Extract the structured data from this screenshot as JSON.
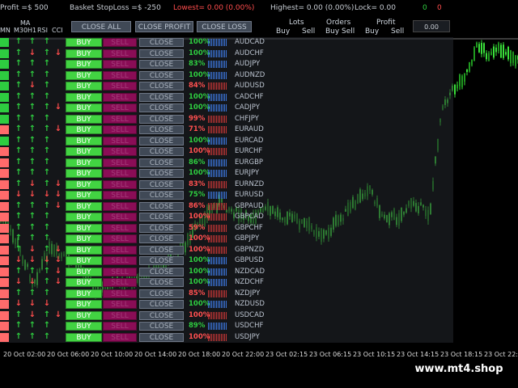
{
  "topbar": {
    "profit": "Profit =$ 500",
    "basket_stoploss": "Basket StopLoss =$ -250",
    "lowest": "Lowest= 0.00 (0.00%)",
    "highest": "Highest= 0.00 (0.00%)",
    "lock": "Lock= 0.00",
    "count_green": "0",
    "count_red": "0"
  },
  "headers": {
    "ma": "MA",
    "mn": "MN",
    "m30": "M30",
    "h1": "H1",
    "rsi": "RSI",
    "cci": "CCI",
    "lots": "Lots",
    "orders": "Orders",
    "profit": "Profit",
    "buy": "Buy",
    "sell": "Sell",
    "profit_value": "0.00"
  },
  "buttons": {
    "close_all": "CLOSE ALL",
    "close_profit": "CLOSE PROFIT",
    "close_loss": "CLOSE LOSS"
  },
  "row_labels": {
    "buy": "BUY",
    "sell": "SELL",
    "close": "CLOSE"
  },
  "colors": {
    "green": "#2ecc40",
    "red": "#ff5050",
    "buy_bg": "#42d342",
    "sell_bg": "#8a0d56",
    "bar_blue": "#3b74d8",
    "bar_red": "#c03535"
  },
  "pairs": [
    {
      "symbol": "AUDCAD",
      "percent": "100%",
      "color": "green",
      "lead": "green",
      "arrows": [
        "up",
        "up",
        "up",
        ""
      ]
    },
    {
      "symbol": "AUDCHF",
      "percent": "100%",
      "color": "green",
      "lead": "green",
      "arrows": [
        "up",
        "down",
        "up",
        "down"
      ]
    },
    {
      "symbol": "AUDJPY",
      "percent": "83%",
      "color": "green",
      "lead": "green",
      "arrows": [
        "up",
        "up",
        "up",
        ""
      ]
    },
    {
      "symbol": "AUDNZD",
      "percent": "100%",
      "color": "green",
      "lead": "green",
      "arrows": [
        "up",
        "up",
        "up",
        ""
      ]
    },
    {
      "symbol": "AUDUSD",
      "percent": "84%",
      "color": "red",
      "lead": "green",
      "arrows": [
        "up",
        "down",
        "up",
        ""
      ]
    },
    {
      "symbol": "CADCHF",
      "percent": "100%",
      "color": "green",
      "lead": "green",
      "arrows": [
        "up",
        "up",
        "up",
        ""
      ]
    },
    {
      "symbol": "CADJPY",
      "percent": "100%",
      "color": "green",
      "lead": "green",
      "arrows": [
        "up",
        "up",
        "up",
        "down"
      ]
    },
    {
      "symbol": "CHFJPY",
      "percent": "99%",
      "color": "red",
      "lead": "green",
      "arrows": [
        "up",
        "up",
        "up",
        ""
      ]
    },
    {
      "symbol": "EURAUD",
      "percent": "71%",
      "color": "red",
      "lead": "red",
      "arrows": [
        "up",
        "up",
        "up",
        "down"
      ]
    },
    {
      "symbol": "EURCAD",
      "percent": "100%",
      "color": "green",
      "lead": "green",
      "arrows": [
        "up",
        "up",
        "up",
        ""
      ]
    },
    {
      "symbol": "EURCHF",
      "percent": "100%",
      "color": "red",
      "lead": "red",
      "arrows": [
        "up",
        "up",
        "up",
        ""
      ]
    },
    {
      "symbol": "EURGBP",
      "percent": "86%",
      "color": "green",
      "lead": "red",
      "arrows": [
        "up",
        "up",
        "up",
        ""
      ]
    },
    {
      "symbol": "EURJPY",
      "percent": "100%",
      "color": "green",
      "lead": "red",
      "arrows": [
        "up",
        "up",
        "up",
        ""
      ]
    },
    {
      "symbol": "EURNZD",
      "percent": "83%",
      "color": "red",
      "lead": "red",
      "arrows": [
        "up",
        "down",
        "up",
        "down"
      ]
    },
    {
      "symbol": "EURUSD",
      "percent": "75%",
      "color": "green",
      "lead": "red",
      "arrows": [
        "down",
        "down",
        "down",
        "down"
      ]
    },
    {
      "symbol": "GBPAUD",
      "percent": "86%",
      "color": "red",
      "lead": "red",
      "arrows": [
        "up",
        "up",
        "up",
        "down"
      ]
    },
    {
      "symbol": "GBPCAD",
      "percent": "100%",
      "color": "red",
      "lead": "red",
      "arrows": [
        "up",
        "up",
        "up",
        ""
      ]
    },
    {
      "symbol": "GBPCHF",
      "percent": "59%",
      "color": "red",
      "lead": "red",
      "arrows": [
        "up",
        "up",
        "up",
        ""
      ]
    },
    {
      "symbol": "GBPJPY",
      "percent": "100%",
      "color": "red",
      "lead": "red",
      "arrows": [
        "up",
        "up",
        "up",
        ""
      ]
    },
    {
      "symbol": "GBPNZD",
      "percent": "100%",
      "color": "red",
      "lead": "red",
      "arrows": [
        "up",
        "down",
        "up",
        "down"
      ]
    },
    {
      "symbol": "GBPUSD",
      "percent": "100%",
      "color": "green",
      "lead": "red",
      "arrows": [
        "down",
        "down",
        "down",
        "down"
      ]
    },
    {
      "symbol": "NZDCAD",
      "percent": "100%",
      "color": "green",
      "lead": "red",
      "arrows": [
        "up",
        "up",
        "up",
        "down"
      ]
    },
    {
      "symbol": "NZDCHF",
      "percent": "100%",
      "color": "green",
      "lead": "red",
      "arrows": [
        "down",
        "down",
        "up",
        "down"
      ]
    },
    {
      "symbol": "NZDJPY",
      "percent": "85%",
      "color": "red",
      "lead": "red",
      "arrows": [
        "up",
        "up",
        "up",
        ""
      ]
    },
    {
      "symbol": "NZDUSD",
      "percent": "100%",
      "color": "green",
      "lead": "red",
      "arrows": [
        "down",
        "down",
        "down",
        ""
      ]
    },
    {
      "symbol": "USDCAD",
      "percent": "100%",
      "color": "red",
      "lead": "red",
      "arrows": [
        "up",
        "down",
        "up",
        "down"
      ]
    },
    {
      "symbol": "USDCHF",
      "percent": "89%",
      "color": "green",
      "lead": "red",
      "arrows": [
        "up",
        "up",
        "up",
        ""
      ]
    },
    {
      "symbol": "USDJPY",
      "percent": "100%",
      "color": "red",
      "lead": "red",
      "arrows": [
        "up",
        "up",
        "up",
        ""
      ]
    }
  ],
  "xaxis": [
    "20 Oct 02:00",
    "20 Oct 06:00",
    "20 Oct 10:00",
    "20 Oct 14:00",
    "20 Oct 18:00",
    "20 Oct 22:00",
    "23 Oct 02:15",
    "23 Oct 06:15",
    "23 Oct 10:15",
    "23 Oct 14:15",
    "23 Oct 18:15",
    "23 Oct 22:"
  ],
  "watermark": "www.mt4.shop"
}
